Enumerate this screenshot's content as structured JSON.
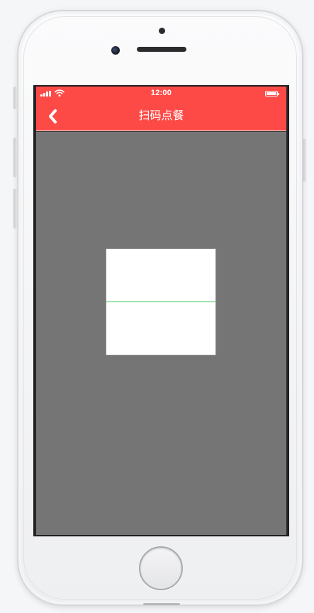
{
  "status_bar": {
    "time": "12:00",
    "signal_icon": "signal-bars-icon",
    "wifi_icon": "wifi-icon",
    "battery_icon": "battery-full-icon"
  },
  "nav": {
    "title": "扫码点餐",
    "back_icon": "chevron-left-icon"
  },
  "scanner": {
    "frame_icon": "scan-frame",
    "line_color": "#35c24a"
  },
  "colors": {
    "accent": "#fe4a46",
    "scan_background": "#757575",
    "scan_frame": "#ffffff",
    "scan_line": "#35c24a"
  }
}
